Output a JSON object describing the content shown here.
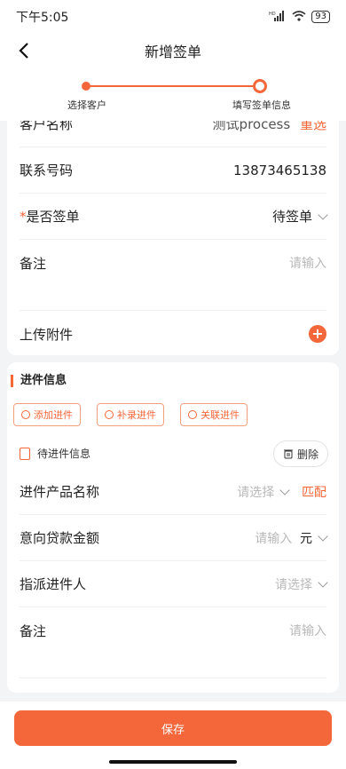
{
  "status_bar": {
    "time": "下午5:05",
    "signal_label": "HD",
    "battery": "93"
  },
  "nav": {
    "title": "新增签单"
  },
  "stepper": {
    "steps": [
      {
        "label": "选择客户"
      },
      {
        "label": "填写签单信息"
      }
    ]
  },
  "customer_form": {
    "partial_label": "客户名称",
    "partial_value": "测试process",
    "partial_action": "重选",
    "phone_label": "联系号码",
    "phone_value": "13873465138",
    "signed_required_mark": "*",
    "signed_label": "是否签单",
    "signed_value": "待签单",
    "remark_label": "备注",
    "remark_placeholder": "请输入",
    "attachment_label": "上传附件",
    "attachment_plus": "+"
  },
  "submission": {
    "section_title": "进件信息",
    "buttons": [
      {
        "label": "添加进件"
      },
      {
        "label": "补录进件"
      },
      {
        "label": "关联进件"
      }
    ],
    "pending_label": "待进件信息",
    "delete_label": "删除",
    "product_label": "进件产品名称",
    "product_placeholder": "请选择",
    "match_label": "匹配",
    "amount_label": "意向贷款金额",
    "amount_placeholder": "请输入",
    "amount_unit": "元",
    "assignee_label": "指派进件人",
    "assignee_placeholder": "请选择",
    "remark_label": "备注",
    "remark_placeholder": "请输入"
  },
  "footer": {
    "save_label": "保存"
  },
  "colors": {
    "accent": "#f3673a"
  }
}
